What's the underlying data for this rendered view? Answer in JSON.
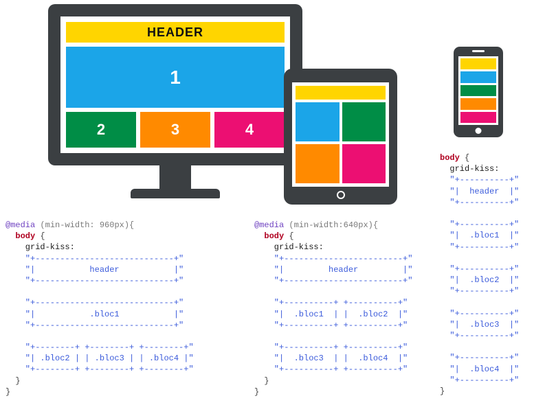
{
  "devices": {
    "desktop": {
      "header": "HEADER",
      "bloc1": "1",
      "bloc2": "2",
      "bloc3": "3",
      "bloc4": "4"
    }
  },
  "code_desktop": {
    "media": "@media",
    "cond": " (min-width: 960px){",
    "selector": "body",
    "open": " {",
    "prop": "    grid-kiss:",
    "rows": [
      "    \"+----------------------------+\"",
      "    \"|           header           |\"",
      "    \"+----------------------------+\"",
      "",
      "    \"+----------------------------+\"",
      "    \"|           .bloc1           |\"",
      "    \"+----------------------------+\"",
      "",
      "    \"+--------+ +--------+ +--------+\"",
      "    \"| .bloc2 | | .bloc3 | | .bloc4 |\"",
      "    \"+--------+ +--------+ +--------+\""
    ],
    "close1": "  }",
    "close2": "}"
  },
  "code_tablet": {
    "media": "@media",
    "cond": " (min-width:640px){",
    "selector": "body",
    "open": " {",
    "prop": "    grid-kiss:",
    "rows": [
      "    \"+------------------------+\"",
      "    \"|         header         |\"",
      "    \"+------------------------+\"",
      "",
      "    \"+----------+ +----------+\"",
      "    \"|  .bloc1  | |  .bloc2  |\"",
      "    \"+----------+ +----------+\"",
      "",
      "    \"+----------+ +----------+\"",
      "    \"|  .bloc3  | |  .bloc4  |\"",
      "    \"+----------+ +----------+\""
    ],
    "close1": "  }",
    "close2": "}"
  },
  "code_phone": {
    "selector": "body",
    "open": " {",
    "prop": "  grid-kiss:",
    "rows": [
      "  \"+----------+\"",
      "  \"|  header  |\"",
      "  \"+----------+\"",
      "",
      "  \"+----------+\"",
      "  \"|  .bloc1  |\"",
      "  \"+----------+\"",
      "",
      "  \"+----------+\"",
      "  \"|  .bloc2  |\"",
      "  \"+----------+\"",
      "",
      "  \"+----------+\"",
      "  \"|  .bloc3  |\"",
      "  \"+----------+\"",
      "",
      "  \"+----------+\"",
      "  \"|  .bloc4  |\"",
      "  \"+----------+\""
    ],
    "close": "}"
  }
}
